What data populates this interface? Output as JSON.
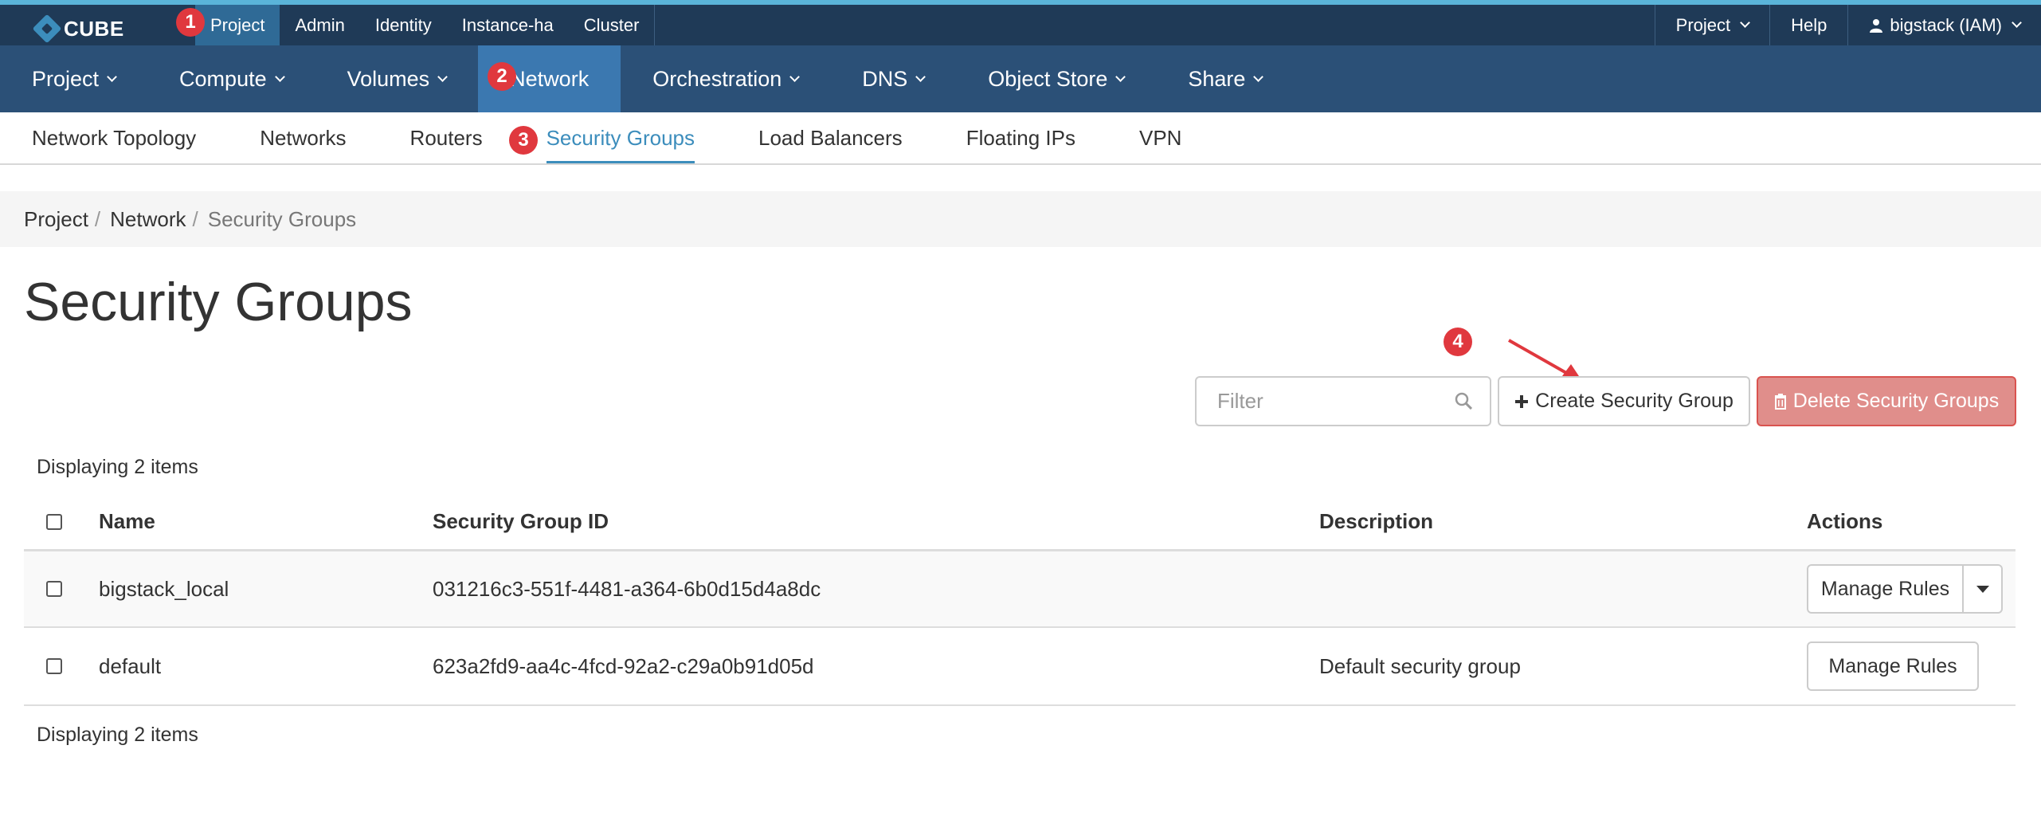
{
  "brand": {
    "name": "CUBE"
  },
  "topnav": {
    "items": [
      "Project",
      "Admin",
      "Identity",
      "Instance-ha",
      "Cluster"
    ],
    "right": {
      "project": "Project",
      "help": "Help",
      "user": "bigstack (IAM)"
    }
  },
  "mainnav": {
    "items": [
      "Project",
      "Compute",
      "Volumes",
      "Network",
      "Orchestration",
      "DNS",
      "Object Store",
      "Share"
    ]
  },
  "subnav": {
    "items": [
      "Network Topology",
      "Networks",
      "Routers",
      "Security Groups",
      "Load Balancers",
      "Floating IPs",
      "VPN"
    ]
  },
  "badges": [
    "1",
    "2",
    "3",
    "4"
  ],
  "breadcrumb": [
    "Project",
    "Network",
    "Security Groups"
  ],
  "page": {
    "title": "Security Groups"
  },
  "actions": {
    "filter_placeholder": "Filter",
    "create": "Create Security Group",
    "delete": "Delete Security Groups"
  },
  "table": {
    "count_label": "Displaying 2 items",
    "headers": [
      "Name",
      "Security Group ID",
      "Description",
      "Actions"
    ],
    "rows": [
      {
        "name": "bigstack_local",
        "id": "031216c3-551f-4481-a364-6b0d15d4a8dc",
        "description": "",
        "action": "Manage Rules"
      },
      {
        "name": "default",
        "id": "623a2fd9-aa4c-4fcd-92a2-c29a0b91d05d",
        "description": "Default security group",
        "action": "Manage Rules"
      }
    ]
  },
  "colors": {
    "topbar": "#1f3a57",
    "mainnav": "#2b5077",
    "active_nav": "#3b78b0",
    "accent": "#3c8dbc",
    "badge": "#e0383e",
    "delete_button": "#e08e8b"
  }
}
